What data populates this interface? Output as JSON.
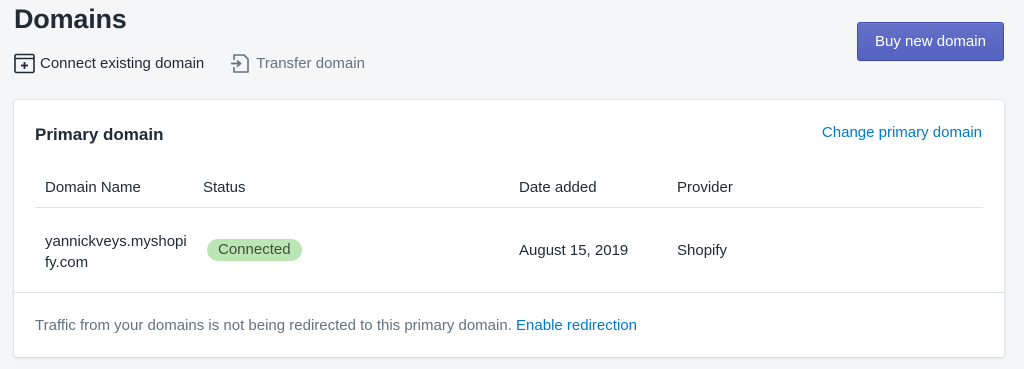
{
  "header": {
    "title": "Domains",
    "connect_label": "Connect existing domain",
    "transfer_label": "Transfer domain",
    "buy_label": "Buy new domain"
  },
  "card": {
    "title": "Primary domain",
    "change_link": "Change primary domain",
    "columns": [
      "Domain Name",
      "Status",
      "Date added",
      "Provider"
    ],
    "rows": [
      {
        "domain": "yannickveys.myshopify.com",
        "status": "Connected",
        "date_added": "August 15, 2019",
        "provider": "Shopify"
      }
    ],
    "footer_text": "Traffic from your domains is not being redirected to this primary domain.",
    "footer_link": "Enable redirection"
  },
  "icons": {
    "connect": "browser-plus-icon",
    "transfer": "transfer-icon"
  },
  "colors": {
    "primary_button": "#5c6ac4",
    "link": "#007ace",
    "badge_success": "#bbe5b3"
  }
}
